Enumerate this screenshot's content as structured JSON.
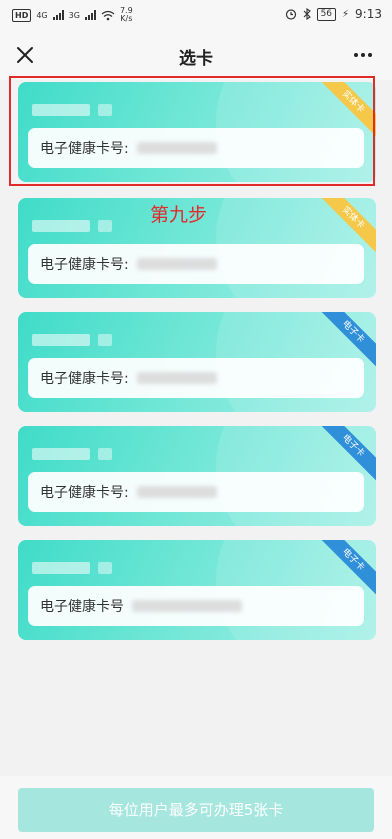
{
  "status_bar": {
    "hd": "HD",
    "signal1": "4G",
    "signal2": "3G",
    "speed_value": "7.9",
    "speed_unit": "K/s",
    "battery": "56",
    "time": "9:13"
  },
  "header": {
    "title": "选卡"
  },
  "cards": [
    {
      "type_badge": "实体卡",
      "badge_color": "#f5c84a",
      "number_label": "电子健康卡号:"
    },
    {
      "type_badge": "实体卡",
      "badge_color": "#f5c84a",
      "number_label": "电子健康卡号:"
    },
    {
      "type_badge": "电子卡",
      "badge_color": "#2f8fd8",
      "number_label": "电子健康卡号:"
    },
    {
      "type_badge": "电子卡",
      "badge_color": "#2f8fd8",
      "number_label": "电子健康卡号:"
    },
    {
      "type_badge": "电子卡",
      "badge_color": "#2f8fd8",
      "number_label": "电子健康卡号"
    }
  ],
  "annotation": {
    "step_text": "第九步"
  },
  "footer": {
    "button_label": "每位用户最多可办理5张卡"
  },
  "colors": {
    "card_accent": "#3fdcc8",
    "highlight_red": "#e02b2b",
    "button_bg": "#a5e6df"
  }
}
